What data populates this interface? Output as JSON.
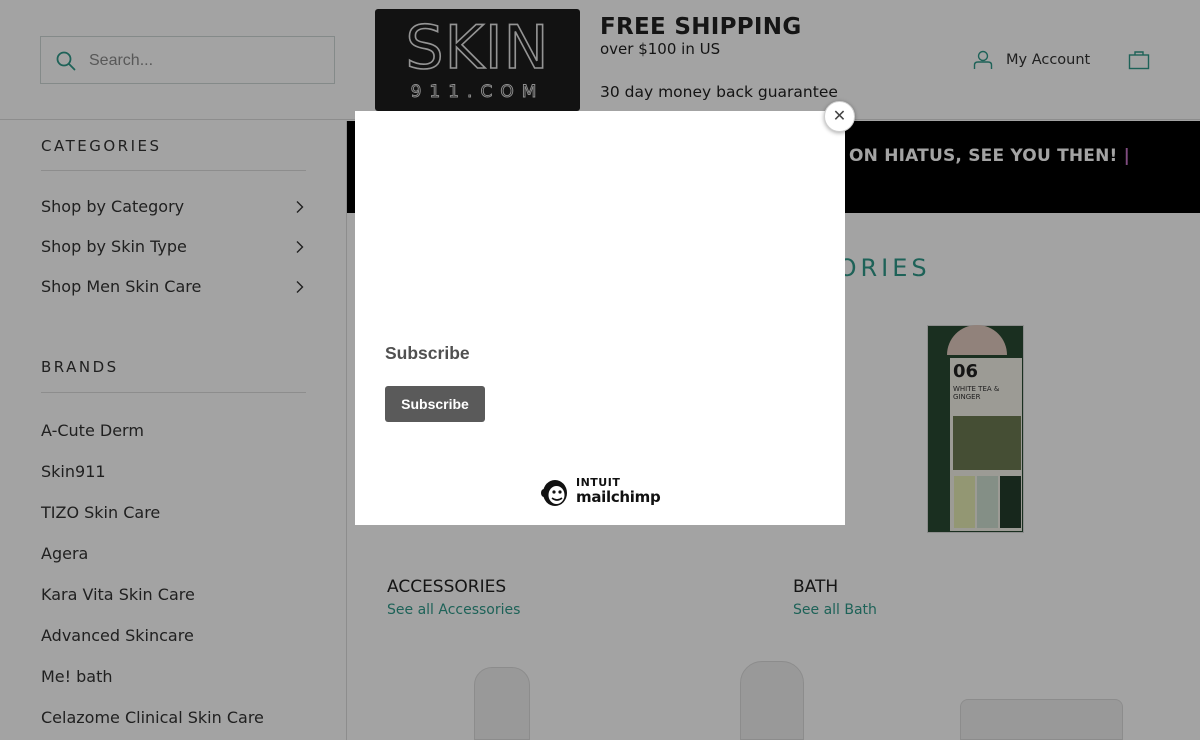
{
  "header": {
    "search": {
      "placeholder": "Search..."
    },
    "logo": {
      "name": "SKIN",
      "domain": "911.COM"
    },
    "promo": {
      "title": "FREE SHIPPING",
      "line1": "over $100 in US",
      "line2": "30 day money back guarantee"
    },
    "account_label": "My Account"
  },
  "sidebar": {
    "categories_heading": "CATEGORIES",
    "categories": [
      {
        "label": "Shop by Category"
      },
      {
        "label": "Shop by Skin Type"
      },
      {
        "label": "Shop Men Skin Care"
      }
    ],
    "brands_heading": "BRANDS",
    "brands": [
      "A-Cute Derm",
      "Skin911",
      "TIZO Skin Care",
      "Agera",
      "Kara Vita Skin Care",
      "Advanced Skincare",
      "Me! bath",
      "Celazome Clinical Skin Care"
    ]
  },
  "main": {
    "announcement": "ON HIATUS, SEE YOU THEN!",
    "announcement_separator": "|",
    "section_title": "GORIES",
    "product": {
      "number": "06",
      "sub": "WHITE TEA & GINGER"
    },
    "categories": [
      {
        "name": "ACCESSORIES",
        "link": "See all Accessories"
      },
      {
        "name": "BATH",
        "link": "See all Bath"
      }
    ]
  },
  "modal": {
    "heading": "Subscribe",
    "button_label": "Subscribe",
    "footer_brand": {
      "intuit": "INTUIT",
      "name": "mailchimp"
    },
    "close_symbol": "✕"
  },
  "colors": {
    "accent_teal": "#2f9a8a",
    "announcement_bg": "#000000",
    "button_bg": "#5a5a5a"
  },
  "icons": [
    "search-icon",
    "user-icon",
    "shopping-bag-icon",
    "chevron-right-icon",
    "close-icon",
    "mailchimp-freddie-icon"
  ]
}
